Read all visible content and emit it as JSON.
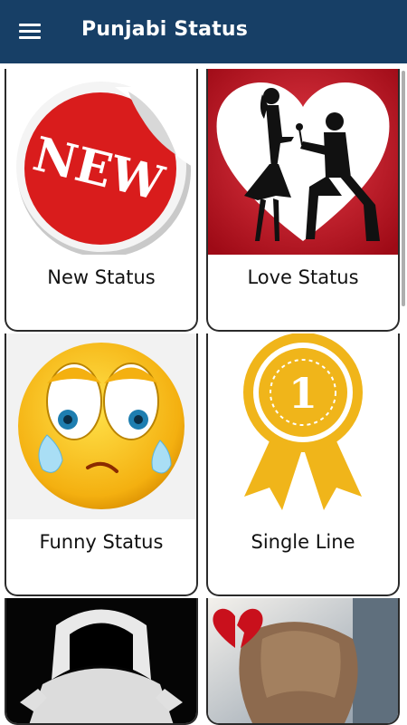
{
  "app": {
    "title": "Punjabi Status"
  },
  "icons": {
    "menu": "hamburger-menu-icon",
    "new": "new-sticker-icon",
    "love": "couple-heart-icon",
    "funny": "crying-emoji-icon",
    "single": "rank-1-ribbon-icon",
    "attitude": "hooded-figure-icon",
    "sad": "broken-heart-icon"
  },
  "cards": [
    {
      "label": "New Status",
      "sticker_text": "NEW"
    },
    {
      "label": "Love Status"
    },
    {
      "label": "Funny Status"
    },
    {
      "label": "Single Line",
      "ribbon_number": "1"
    },
    {
      "label": ""
    },
    {
      "label": ""
    }
  ],
  "colors": {
    "appbar": "#173f66",
    "new_red": "#d91c1c",
    "heart_red": "#c8101e",
    "gold": "#f0b51a"
  }
}
